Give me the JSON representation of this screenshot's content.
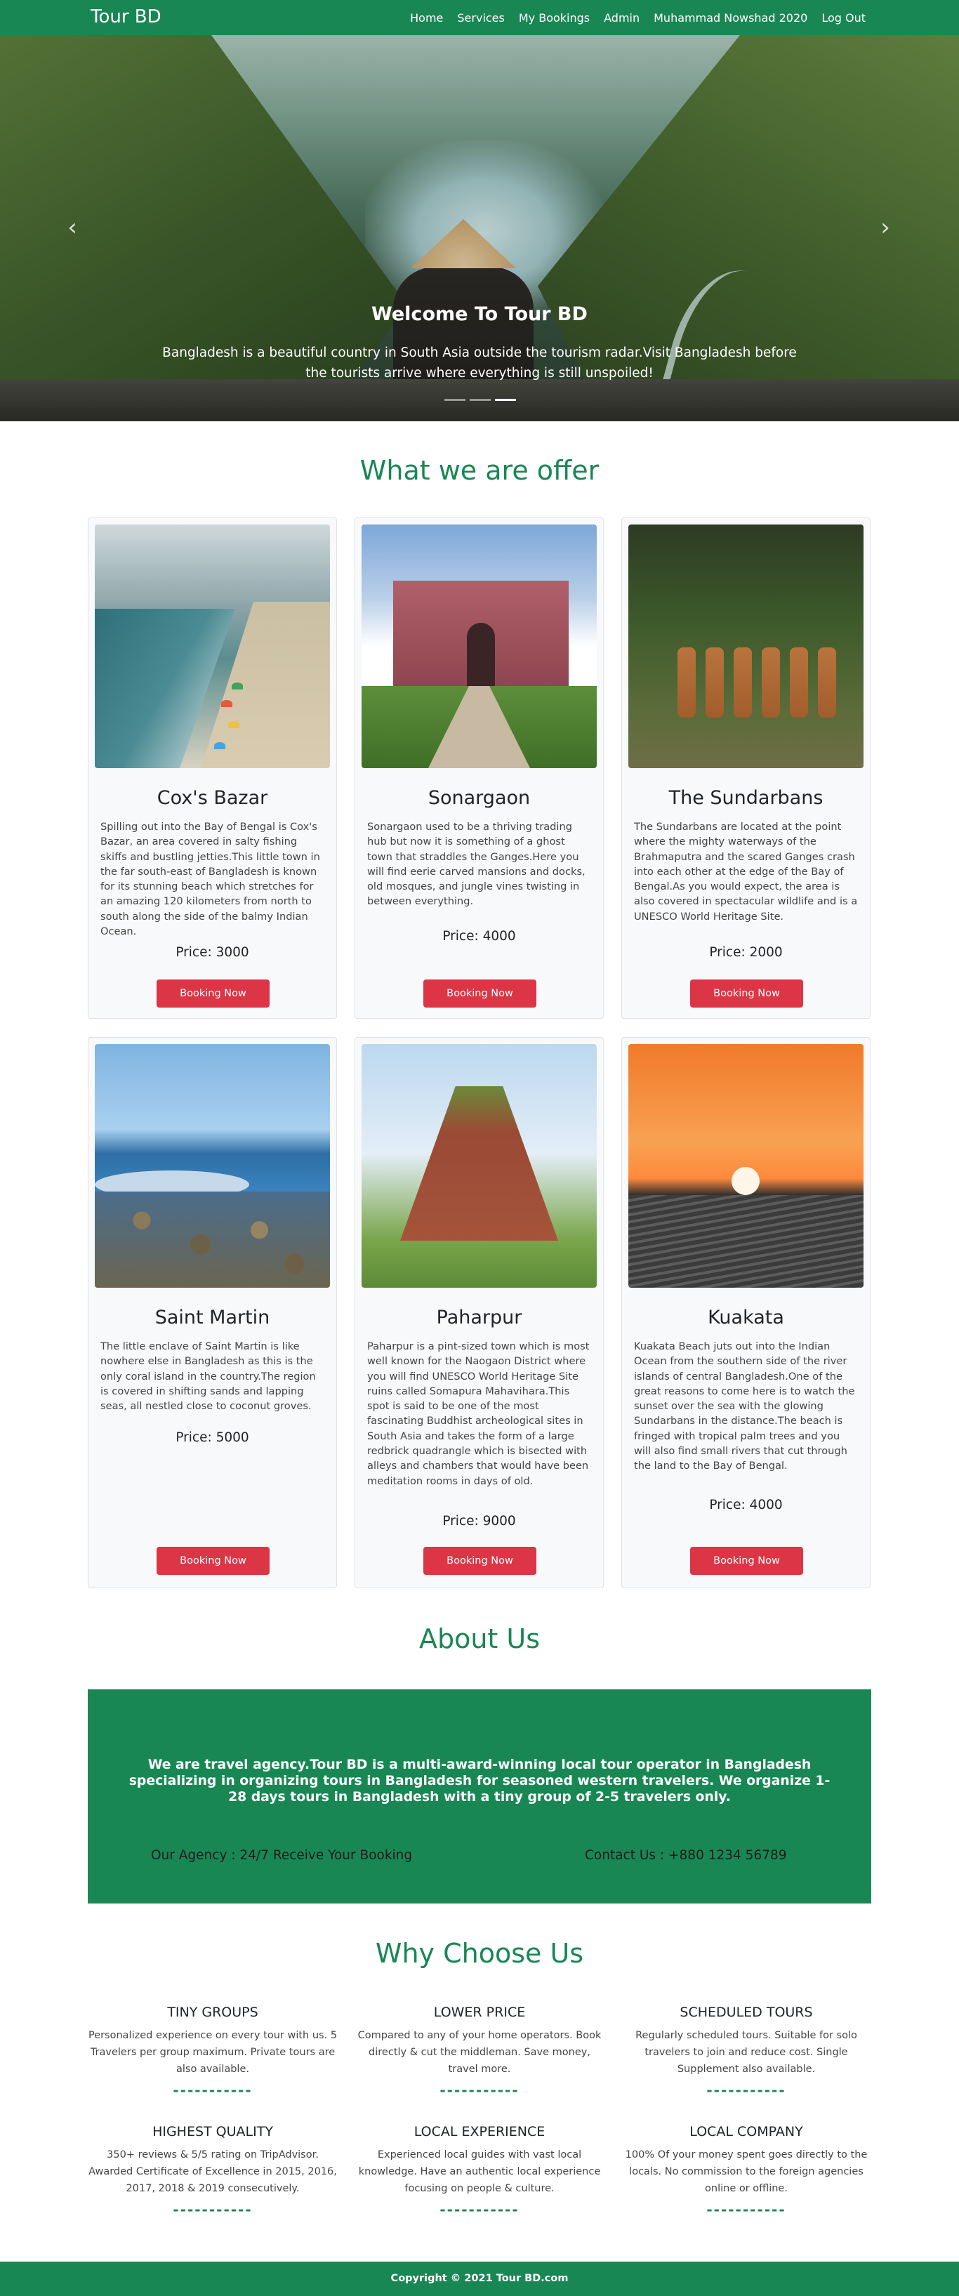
{
  "colors": {
    "primary": "#198754",
    "danger": "#dc3545",
    "card_bg": "#f8f9fa"
  },
  "navbar": {
    "brand": "Tour BD",
    "links": [
      "Home",
      "Services",
      "My Bookings",
      "Admin",
      "Muhammad Nowshad 2020",
      "Log Out"
    ]
  },
  "hero": {
    "title": "Welcome To Tour BD",
    "text": "Bangladesh is a beautiful country in South Asia outside the tourism radar.Visit Bangladesh before the tourists arrive where everything is still unspoiled!",
    "prev_icon": "chevron-left-icon",
    "next_icon": "chevron-right-icon",
    "slides": 3,
    "active_slide": 3
  },
  "offer": {
    "title": "What we are offer",
    "button_label": "Booking Now",
    "cards": [
      {
        "name": "Cox's Bazar",
        "desc": "Spilling out into the Bay of Bengal is Cox's Bazar, an area covered in salty fishing skiffs and bustling jetties.This little town in the far south-east of Bangladesh is known for its stunning beach which stretches for an amazing 120 kilometers from north to south along the side of the balmy Indian Ocean.",
        "price": "Price: 3000"
      },
      {
        "name": "Sonargaon",
        "desc": "Sonargaon used to be a thriving trading hub but now it is something of a ghost town that straddles the Ganges.Here you will find eerie carved mansions and docks, old mosques, and jungle vines twisting in between everything.",
        "price": "Price: 4000"
      },
      {
        "name": "The Sundarbans",
        "desc": "The Sundarbans are located at the point where the mighty waterways of the Brahmaputra and the scared Ganges crash into each other at the edge of the Bay of Bengal.As you would expect, the area is also covered in spectacular wildlife and is a UNESCO World Heritage Site.",
        "price": "Price: 2000"
      },
      {
        "name": "Saint Martin",
        "desc": "The little enclave of Saint Martin is like nowhere else in Bangladesh as this is the only coral island in the country.The region is covered in shifting sands and lapping seas, all nestled close to coconut groves.",
        "price": "Price: 5000"
      },
      {
        "name": "Paharpur",
        "desc": "Paharpur is a pint-sized town which is most well known for the Naogaon District where you will find UNESCO World Heritage Site ruins called Somapura Mahavihara.This spot is said to be one of the most fascinating Buddhist archeological sites in South Asia and takes the form of a large redbrick quadrangle which is bisected with alleys and chambers that would have been meditation rooms in days of old.",
        "price": "Price: 9000"
      },
      {
        "name": "Kuakata",
        "desc": "Kuakata Beach juts out into the Indian Ocean from the southern side of the river islands of central Bangladesh.One of the great reasons to come here is to watch the sunset over the sea with the glowing Sundarbans in the distance.The beach is fringed with tropical palm trees and you will also find small rivers that cut through the land to the Bay of Bengal.",
        "price": "Price: 4000"
      }
    ]
  },
  "about": {
    "title": "About Us",
    "text": "We are travel agency.Tour BD is a multi-award-winning local tour operator in Bangladesh specializing in organizing tours in Bangladesh for seasoned western travelers. We organize 1-28 days tours in Bangladesh with a tiny group of 2-5 travelers only.",
    "agency": "Our Agency : 24/7 Receive Your Booking",
    "contact": "Contact Us : +880 1234 56789"
  },
  "why": {
    "title": "Why Choose Us",
    "divider": "-----------",
    "features": [
      {
        "title": "TINY GROUPS",
        "desc": "Personalized experience on every tour with us. 5 Travelers per group maximum. Private tours are also available."
      },
      {
        "title": "LOWER PRICE",
        "desc": "Compared to any of your home operators. Book directly & cut the middleman. Save money, travel more."
      },
      {
        "title": "SCHEDULED TOURS",
        "desc": "Regularly scheduled tours. Suitable for solo travelers to join and reduce cost. Single Supplement also available."
      },
      {
        "title": "HIGHEST QUALITY",
        "desc": "350+ reviews & 5/5 rating on TripAdvisor. Awarded Certificate of Excellence in 2015, 2016, 2017, 2018 & 2019 consecutively."
      },
      {
        "title": "LOCAL EXPERIENCE",
        "desc": "Experienced local guides with vast local knowledge. Have an authentic local experience focusing on people & culture."
      },
      {
        "title": "LOCAL COMPANY",
        "desc": "100% Of your money spent goes directly to the locals. No commission to the foreign agencies online or offline."
      }
    ]
  },
  "footer": {
    "copyright": "Copyright © 2021 Tour BD.com"
  }
}
